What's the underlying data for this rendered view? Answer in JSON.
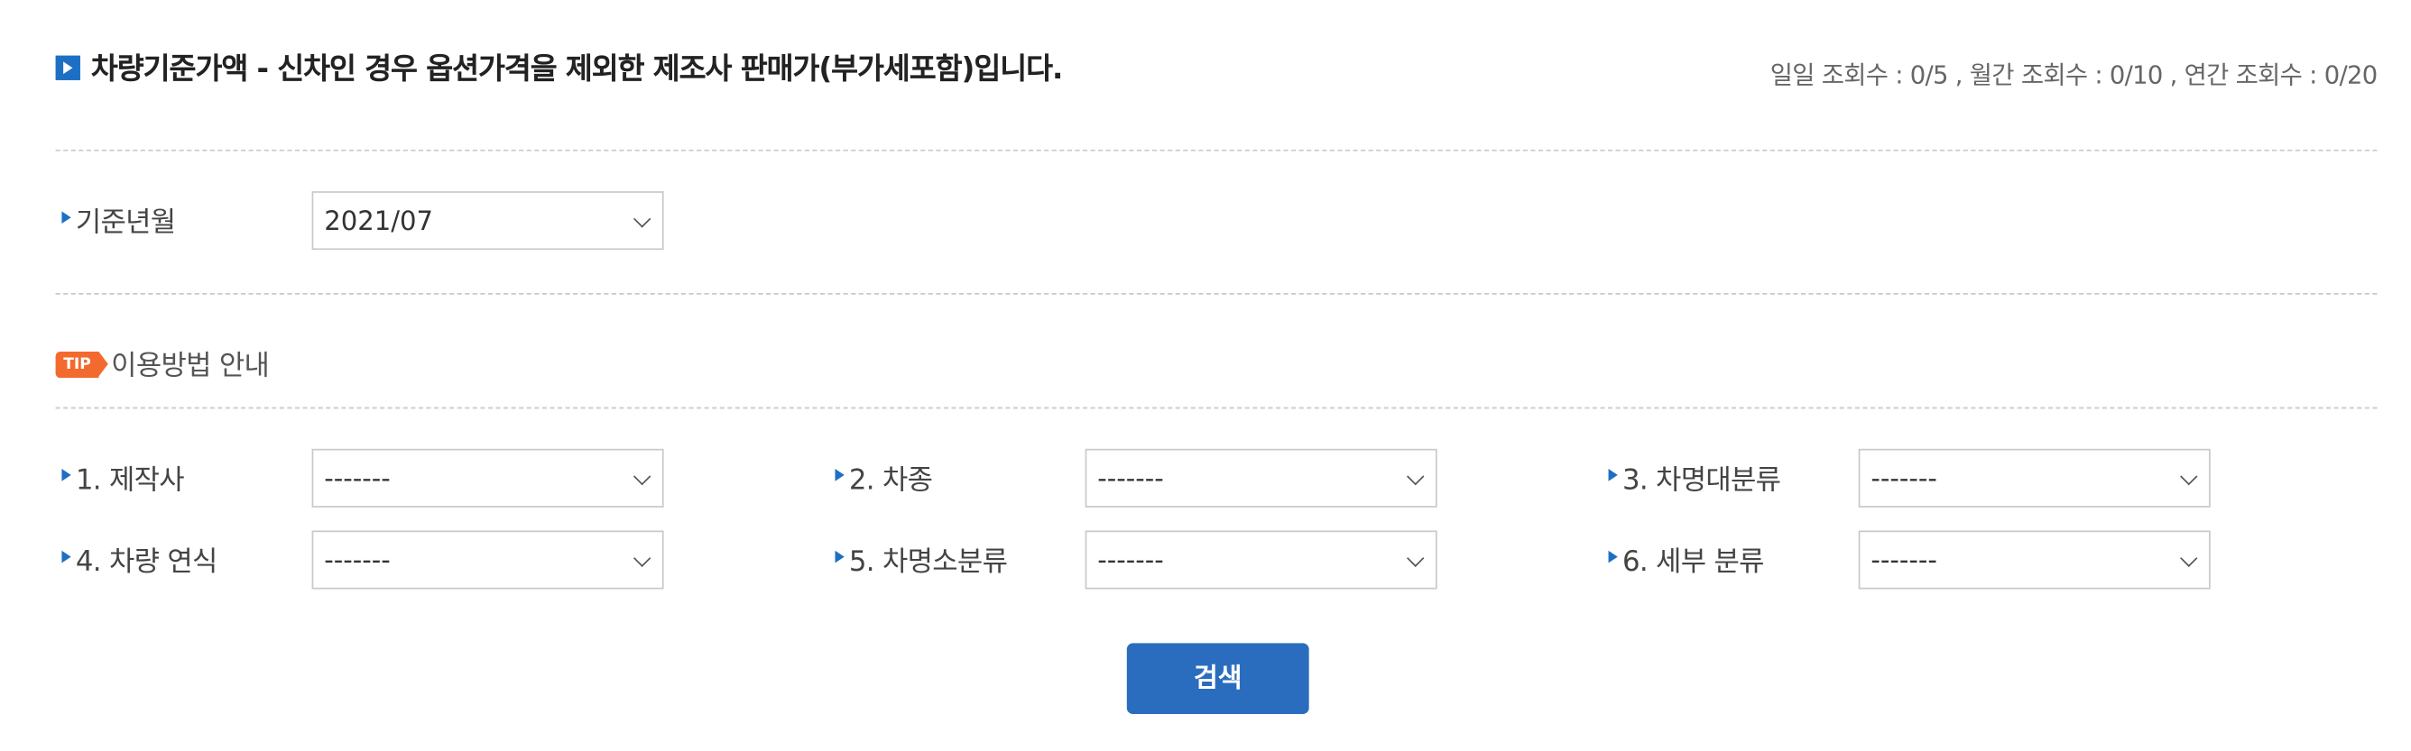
{
  "header": {
    "title": "차량기준가액 - 신차인 경우 옵션가격을 제외한 제조사 판매가(부가세포함)입니다.",
    "counts": "일일 조회수 : 0/5 , 월간 조회수 : 0/10 , 연간 조회수 : 0/20"
  },
  "base_month": {
    "label": "기준년월",
    "value": "2021/07"
  },
  "tip": {
    "badge": "TIP",
    "text": "이용방법 안내"
  },
  "filters": [
    {
      "label": "1. 제작사",
      "value": "-------"
    },
    {
      "label": "2. 차종",
      "value": "-------"
    },
    {
      "label": "3. 차명대분류",
      "value": "-------"
    },
    {
      "label": "4. 차량 연식",
      "value": "-------"
    },
    {
      "label": "5. 차명소분류",
      "value": "-------"
    },
    {
      "label": "6. 세부 분류",
      "value": "-------"
    }
  ],
  "search_button": {
    "label": "검색"
  },
  "colors": {
    "accent_blue": "#2a6dbe",
    "tip_orange": "#f26a2e",
    "border_gray": "#c9c9c9"
  }
}
